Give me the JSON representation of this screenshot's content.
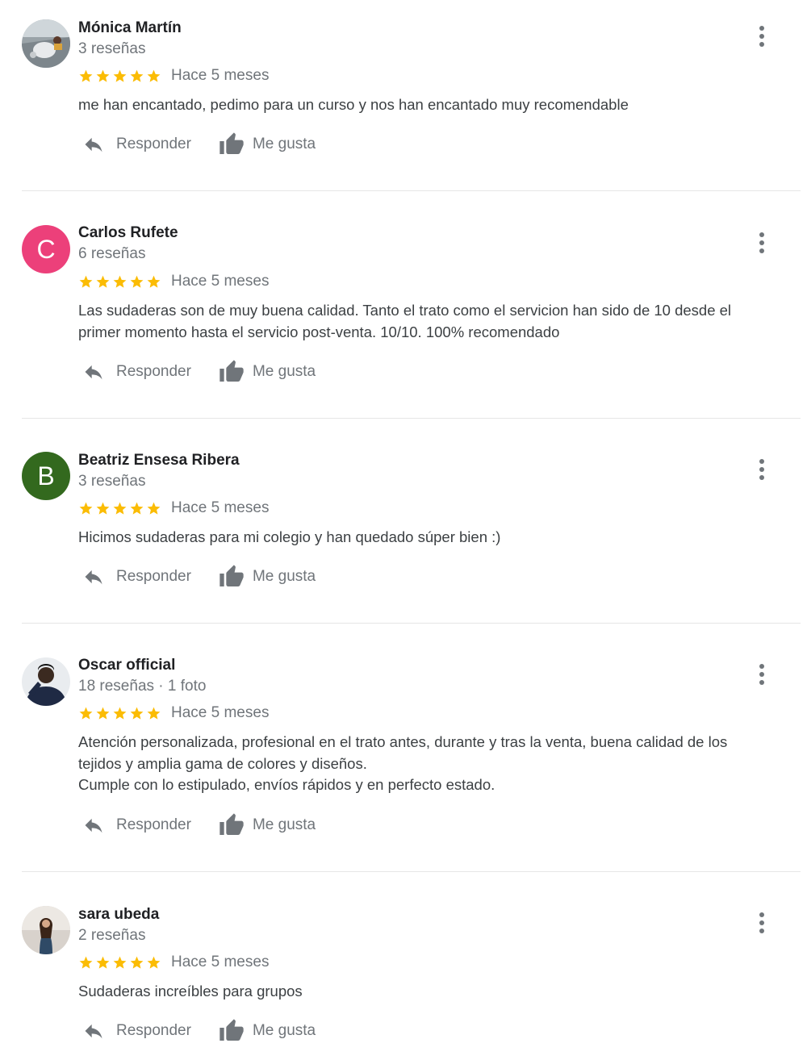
{
  "colors": {
    "star": "#fbbc04",
    "name": "#202124",
    "meta": "#70757a",
    "text": "#3c4043",
    "icon": "#70757a",
    "divider": "#e6e6e6"
  },
  "actions": {
    "reply_label": "Responder",
    "like_label": "Me gusta"
  },
  "reviews": [
    {
      "name": "Mónica Martín",
      "meta": "3 reseñas",
      "rating": 5,
      "date": "Hace 5 meses",
      "text": "me han encantado, pedimo para un curso y nos han encantado muy recomendable",
      "avatar": {
        "type": "photo"
      }
    },
    {
      "name": "Carlos Rufete",
      "meta": "6 reseñas",
      "rating": 5,
      "date": "Hace 5 meses",
      "text": "Las sudaderas son de muy buena calidad. Tanto el trato como el servicion han sido de 10 desde el primer momento hasta el servicio post-venta. 10/10. 100% recomendado",
      "avatar": {
        "type": "letter",
        "letter": "C",
        "color": "#ec407a"
      }
    },
    {
      "name": "Beatriz Ensesa Ribera",
      "meta": "3 reseñas",
      "rating": 5,
      "date": "Hace 5 meses",
      "text": "Hicimos sudaderas para mi colegio y han quedado súper bien :)",
      "avatar": {
        "type": "letter",
        "letter": "B",
        "color": "#33691e"
      }
    },
    {
      "name": "Oscar official",
      "meta": "18 reseñas · 1 foto",
      "rating": 5,
      "date": "Hace 5 meses",
      "text": "Atención personalizada, profesional en el trato antes, durante y tras la venta, buena calidad de los tejidos y amplia gama de colores y diseños.\nCumple con lo estipulado, envíos rápidos y en perfecto estado.",
      "avatar": {
        "type": "photo"
      }
    },
    {
      "name": "sara ubeda",
      "meta": "2 reseñas",
      "rating": 5,
      "date": "Hace 5 meses",
      "text": "Sudaderas increíbles para grupos",
      "avatar": {
        "type": "photo"
      }
    }
  ]
}
